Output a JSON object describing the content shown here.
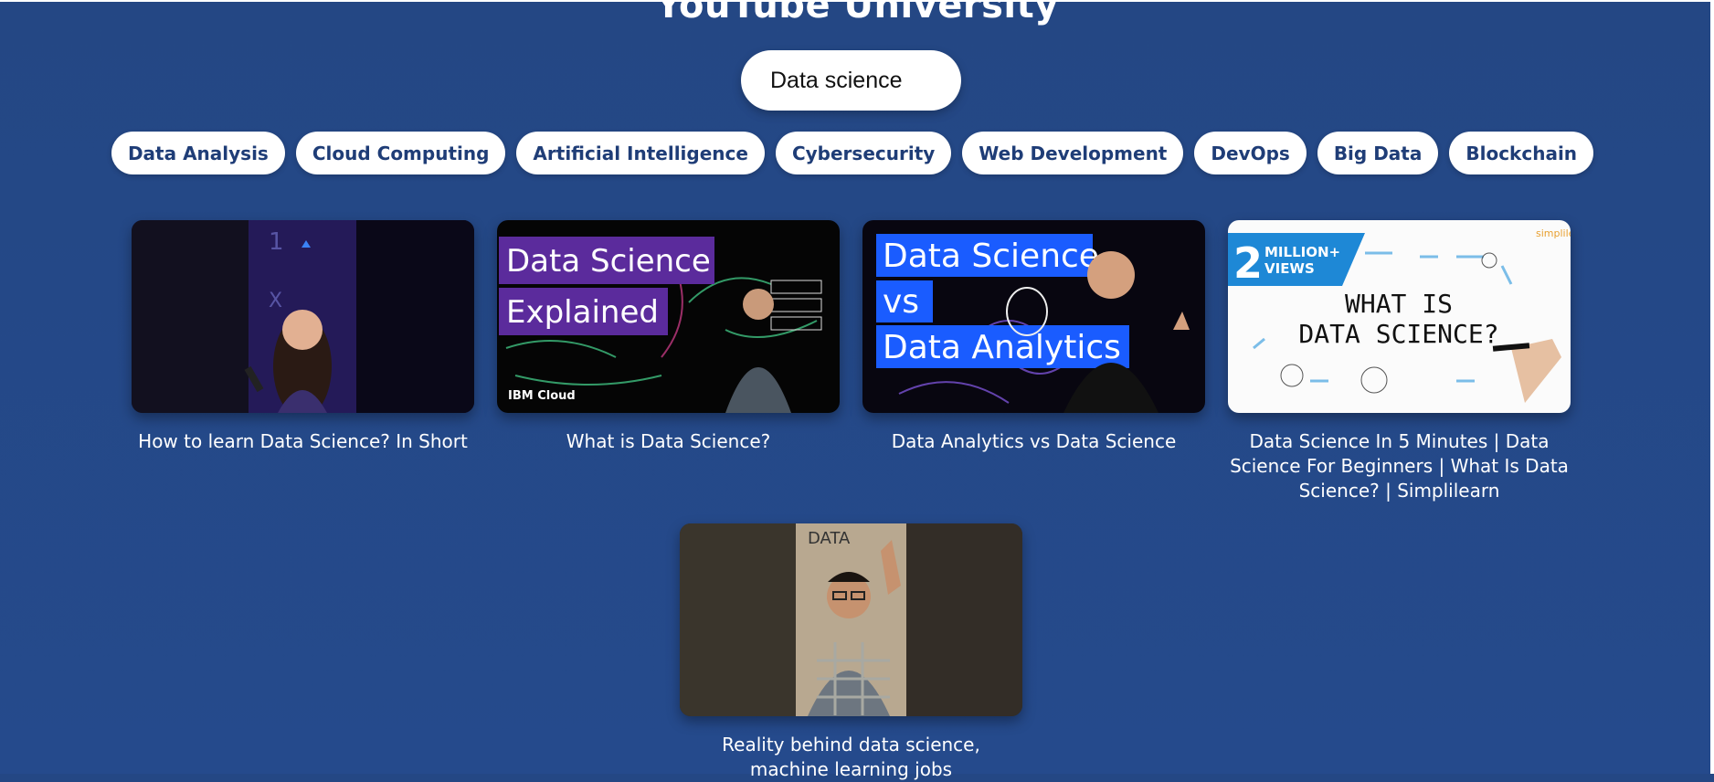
{
  "page": {
    "title": "YouTube University"
  },
  "search": {
    "value": "Data science"
  },
  "topics": [
    "Data Analysis",
    "Cloud Computing",
    "Artificial Intelligence",
    "Cybersecurity",
    "Web Development",
    "DevOps",
    "Big Data",
    "Blockchain"
  ],
  "videos": [
    {
      "title": "How to learn Data Science? In Short"
    },
    {
      "title": "What is Data Science?",
      "overlay_line1": "Data Science",
      "overlay_line2": "Explained",
      "brand": "IBM Cloud"
    },
    {
      "title": "Data Analytics vs Data Science",
      "overlay_line1": "Data Science",
      "overlay_line2": "vs",
      "overlay_line3": "Data Analytics"
    },
    {
      "title": "Data Science In 5 Minutes | Data Science For Beginners | What Is Data Science? | Simplilearn",
      "badge_number": "2",
      "badge_line1": "MILLION+",
      "badge_line2": "VIEWS",
      "heading_line1": "WHAT IS",
      "heading_line2": "DATA SCIENCE?",
      "logo": "simplilearn"
    },
    {
      "title": "Reality behind data science, machine learning jobs",
      "poster_text": "DATA"
    }
  ],
  "colors": {
    "background": "#244784",
    "chip_text": "#1f3d77",
    "chip_bg": "#ffffff",
    "overlay_purple": "#5b2b9c",
    "overlay_blue": "#1a5cff"
  }
}
